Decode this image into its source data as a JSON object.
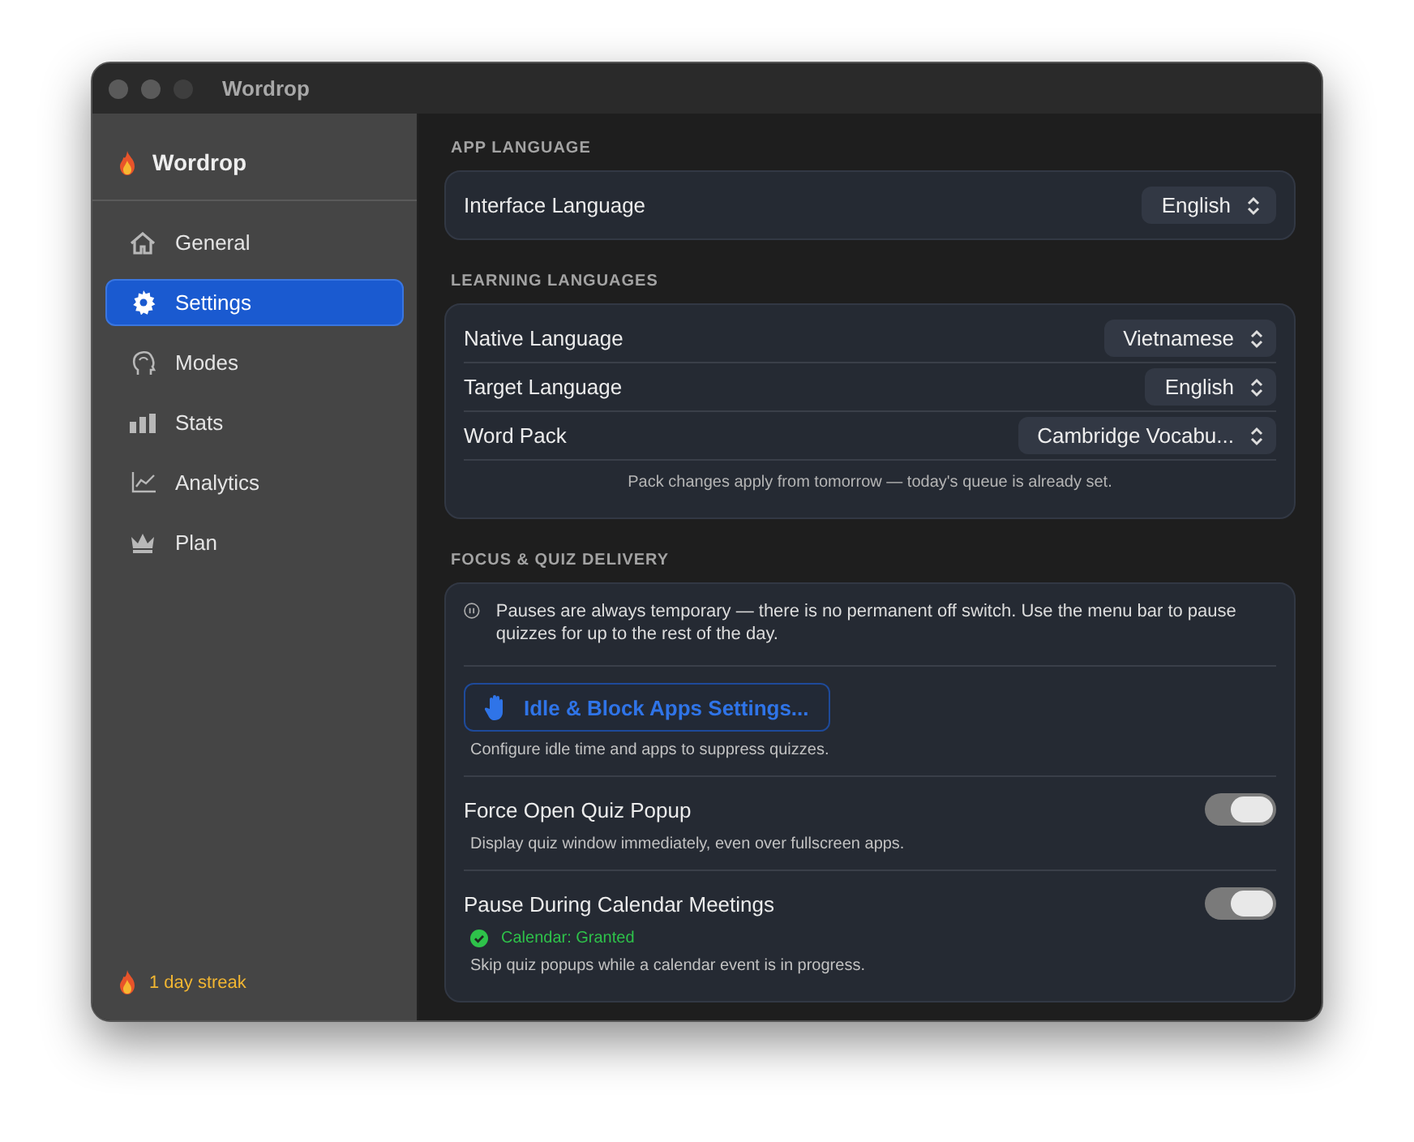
{
  "window": {
    "title": "Wordrop"
  },
  "sidebar": {
    "app_name": "Wordrop",
    "items": [
      {
        "label": "General",
        "kind": "house",
        "selected": false
      },
      {
        "label": "Settings",
        "kind": "gear",
        "selected": true
      },
      {
        "label": "Modes",
        "kind": "head",
        "selected": false
      },
      {
        "label": "Stats",
        "kind": "bars",
        "selected": false
      },
      {
        "label": "Analytics",
        "kind": "chart",
        "selected": false
      },
      {
        "label": "Plan",
        "kind": "crown",
        "selected": false
      }
    ],
    "streak": "1 day streak"
  },
  "sections": [
    {
      "title": "APP LANGUAGE",
      "rows": [
        {
          "kind": "picker",
          "label": "Interface Language",
          "value": "English"
        }
      ]
    },
    {
      "title": "LEARNING LANGUAGES",
      "rows": [
        {
          "kind": "picker",
          "label": "Native Language",
          "value": "Vietnamese"
        },
        {
          "kind": "picker",
          "label": "Target Language",
          "value": "English"
        },
        {
          "kind": "picker",
          "label": "Word Pack",
          "value": "Cambridge Vocabu..."
        },
        {
          "kind": "note",
          "text": "Pack changes apply from tomorrow — today's queue is already set."
        }
      ]
    },
    {
      "title": "FOCUS & QUIZ DELIVERY",
      "rows": [
        {
          "kind": "info",
          "text": "Pauses are always temporary — there is no permanent off switch. Use the menu bar to pause quizzes for up to the rest of the day."
        },
        {
          "kind": "button",
          "label": "Idle & Block Apps Settings...",
          "caption": "Configure idle time and apps to suppress quizzes."
        },
        {
          "kind": "toggle",
          "label": "Force Open Quiz Popup",
          "on": true,
          "caption": "Display quiz window immediately, even over fullscreen apps."
        },
        {
          "kind": "toggle",
          "label": "Pause During Calendar Meetings",
          "on": true,
          "status": "Calendar: Granted",
          "caption": "Skip quiz popups while a calendar event is in progress."
        }
      ]
    }
  ]
}
